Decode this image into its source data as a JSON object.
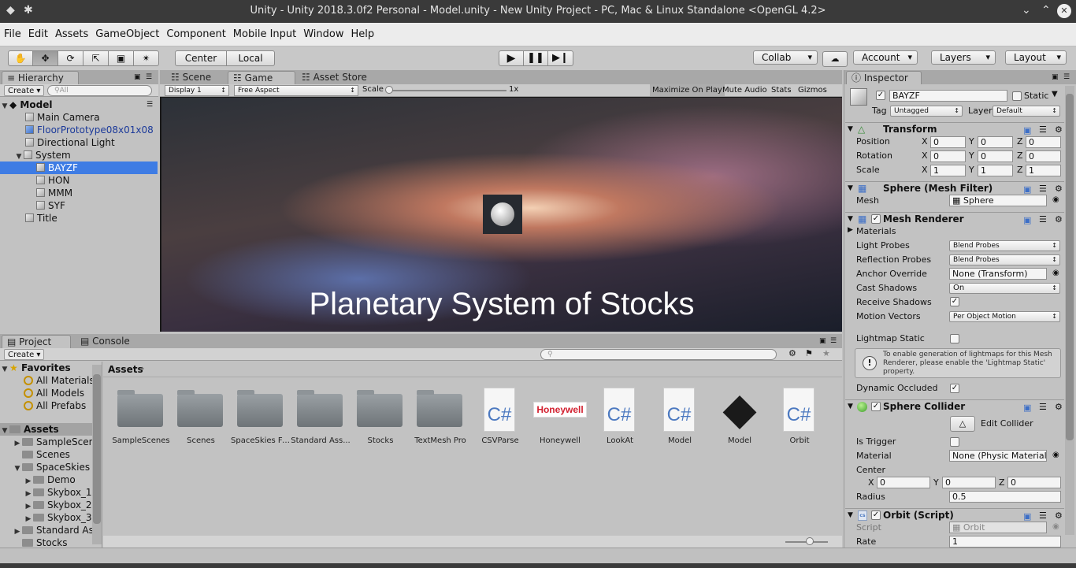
{
  "window": {
    "title": "Unity - Unity 2018.3.0f2 Personal - Model.unity - New Unity Project - PC, Mac & Linux Standalone <OpenGL 4.2>",
    "min": "⌄",
    "max": "⌃",
    "close": "✕"
  },
  "menu": [
    "File",
    "Edit",
    "Assets",
    "GameObject",
    "Component",
    "Mobile Input",
    "Window",
    "Help"
  ],
  "toolbar": {
    "center": "Center",
    "local": "Local",
    "collab": "Collab",
    "account": "Account",
    "layers": "Layers",
    "layout": "Layout"
  },
  "hierarchy": {
    "tab": "Hierarchy",
    "create": "Create",
    "search": "All",
    "scene": "Model",
    "rows": [
      "Main Camera",
      "FloorPrototype08x01x08",
      "Directional Light",
      "System",
      "BAYZF",
      "HON",
      "MMM",
      "SYF",
      "Title"
    ]
  },
  "tabs": {
    "scene": "Scene",
    "game": "Game",
    "store": "Asset Store"
  },
  "game": {
    "display": "Display 1",
    "aspect": "Free Aspect",
    "scale_label": "Scale",
    "scale": "1x",
    "maximize": "Maximize On Play",
    "mute": "Mute Audio",
    "stats": "Stats",
    "gizmos": "Gizmos",
    "overlay": "Planetary System of Stocks"
  },
  "project": {
    "tab": "Project",
    "console": "Console",
    "create": "Create",
    "breadcrumb": "Assets",
    "favorites": "Favorites",
    "fav_items": [
      "All Materials",
      "All Models",
      "All Prefabs"
    ],
    "tree_root": "Assets",
    "tree": [
      "SampleScene",
      "Scenes",
      "SpaceSkies F",
      "Demo",
      "Skybox_1",
      "Skybox_2",
      "Skybox_3",
      "Standard Ass",
      "Stocks"
    ],
    "assets": [
      "SampleScenes",
      "Scenes",
      "SpaceSkies Fr...",
      "Standard Ass...",
      "Stocks",
      "TextMesh Pro",
      "CSVParse",
      "Honeywell",
      "LookAt",
      "Model",
      "Model",
      "Orbit"
    ],
    "csharp": "C#",
    "honeywell_logo": "Honeywell"
  },
  "inspector": {
    "tab": "Inspector",
    "name": "BAYZF",
    "static": "Static",
    "tag_label": "Tag",
    "tag": "Untagged",
    "layer_label": "Layer",
    "layer": "Default",
    "transform": "Transform",
    "position": "Position",
    "rotation": "Rotation",
    "scale": "Scale",
    "pos": [
      "0",
      "0",
      "0"
    ],
    "rot": [
      "0",
      "0",
      "0"
    ],
    "scl": [
      "1",
      "1",
      "1"
    ],
    "x": "X",
    "y": "Y",
    "z": "Z",
    "meshfilter": "Sphere (Mesh Filter)",
    "mesh_label": "Mesh",
    "mesh": "Sphere",
    "meshrenderer": "Mesh Renderer",
    "materials": "Materials",
    "light_probes": "Light Probes",
    "light_probes_v": "Blend Probes",
    "refl_probes": "Reflection Probes",
    "refl_probes_v": "Blend Probes",
    "anchor": "Anchor Override",
    "anchor_v": "None (Transform)",
    "cast": "Cast Shadows",
    "cast_v": "On",
    "receive": "Receive Shadows",
    "motion": "Motion Vectors",
    "motion_v": "Per Object Motion",
    "lightmap": "Lightmap Static",
    "info": "To enable generation of lightmaps for this Mesh Renderer, please enable the 'Lightmap Static' property.",
    "occluded": "Dynamic Occluded",
    "collider": "Sphere Collider",
    "edit_collider": "Edit Collider",
    "trigger": "Is Trigger",
    "material": "Material",
    "material_v": "None (Physic Material)",
    "center": "Center",
    "center_v": [
      "0",
      "0",
      "0"
    ],
    "radius": "Radius",
    "radius_v": "0.5",
    "orbit": "Orbit (Script)",
    "script": "Script",
    "script_v": "Orbit",
    "rate": "Rate",
    "rate_v": "1"
  }
}
